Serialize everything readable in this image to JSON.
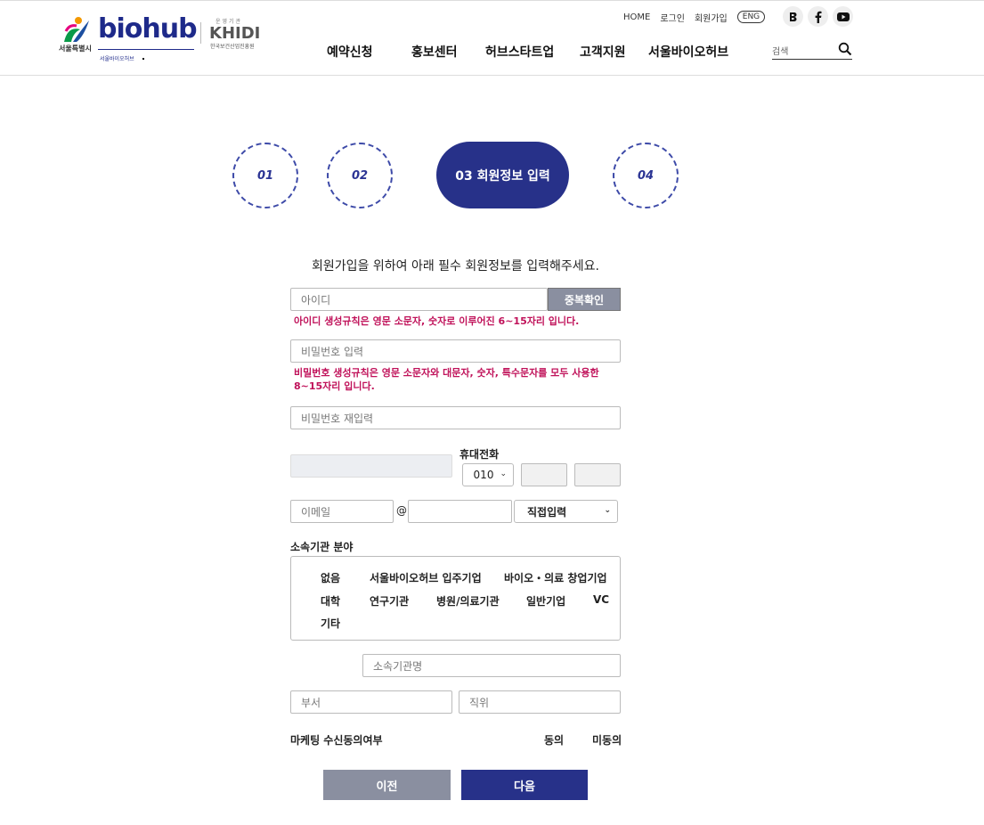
{
  "header": {
    "logo": {
      "seoul_text": "서울특별시",
      "biohub": "biohub",
      "biohub_sub": "서울바이오허브",
      "khidi_top": "운영기관",
      "khidi": "KHIDI",
      "khidi_sub": "한국보건산업진흥원"
    },
    "util": {
      "home": "HOME",
      "login": "로그인",
      "join": "회원가입",
      "eng": "ENG"
    },
    "sns": [
      "blog-icon",
      "facebook-icon",
      "youtube-icon"
    ],
    "nav": [
      "예약신청",
      "홍보센터",
      "허브스타트업",
      "고객지원",
      "서울바이오허브"
    ],
    "search": {
      "placeholder": "검색"
    }
  },
  "steps": {
    "s1": "01",
    "s2": "02",
    "active": "03  회원정보 입력",
    "s4": "04"
  },
  "form": {
    "intro": "회원가입을 위하여 아래 필수 회원정보를 입력해주세요.",
    "id_placeholder": "아이디",
    "dup_button": "중복확인",
    "id_rule": "아이디 생성규칙은 영문 소문자, 숫자로 이루어진 6~15자리 입니다.",
    "pw_placeholder": "비밀번호 입력",
    "pw_rule": "비밀번호 생성규칙은 영문 소문자와 대문자, 숫자, 특수문자를 모두 사용한 8~15자리 입니다.",
    "pw2_placeholder": "비밀번호 재입력",
    "phone_label": "휴대전화",
    "phone_prefix": "010",
    "email_placeholder": "이메일",
    "email_at": "@",
    "email_domain_select": "직접입력",
    "field_label": "소속기관 분야",
    "field_options": {
      "none": "없음",
      "resident": "서울바이오허브 입주기업",
      "startup": "바이오・의료 창업기업",
      "univ": "대학",
      "research": "연구기관",
      "hospital": "병원/의료기관",
      "company": "일반기업",
      "vc": "VC",
      "etc": "기타"
    },
    "org_placeholder": "소속기관명",
    "dept_placeholder": "부서",
    "position_placeholder": "직위",
    "marketing_label": "마케팅 수신동의여부",
    "agree": "동의",
    "disagree": "미동의",
    "prev": "이전",
    "next": "다음"
  },
  "colors": {
    "primary": "#273189",
    "error": "#c0125a",
    "gray_button": "#8a8fa0"
  }
}
